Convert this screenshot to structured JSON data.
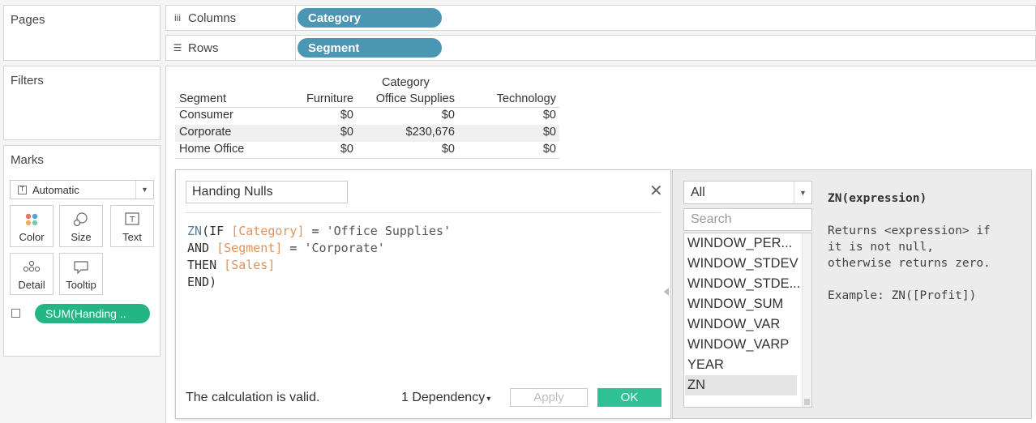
{
  "panels": {
    "pages": "Pages",
    "filters": "Filters",
    "marks": "Marks"
  },
  "marks": {
    "mark_type": "Automatic",
    "buttons": {
      "color": "Color",
      "size": "Size",
      "text": "Text",
      "detail": "Detail",
      "tooltip": "Tooltip"
    },
    "text_pill": "SUM(Handing .."
  },
  "shelves": {
    "columns_label": "Columns",
    "columns_pill": "Category",
    "rows_label": "Rows",
    "rows_pill": "Segment"
  },
  "crosstab": {
    "category_header": "Category",
    "row_header": "Segment",
    "columns": [
      "Furniture",
      "Office Supplies",
      "Technology"
    ],
    "rows": [
      {
        "segment": "Consumer",
        "values": [
          "$0",
          "$0",
          "$0"
        ]
      },
      {
        "segment": "Corporate",
        "values": [
          "$0",
          "$230,676",
          "$0"
        ]
      },
      {
        "segment": "Home Office",
        "values": [
          "$0",
          "$0",
          "$0"
        ]
      }
    ]
  },
  "calc": {
    "name": "Handing Nulls",
    "code": {
      "fn": "ZN",
      "l1_a": "(IF ",
      "f_category": "[Category]",
      "l1_b": " = ",
      "s_office": "'Office Supplies'",
      "l2_a": "AND ",
      "f_segment": "[Segment]",
      "l2_b": " = ",
      "s_corp": "'Corporate'",
      "l3_a": "THEN ",
      "f_sales": "[Sales]",
      "l4": "END)"
    },
    "status": "The calculation is valid.",
    "dependency": "1 Dependency",
    "apply": "Apply",
    "ok": "OK"
  },
  "functions": {
    "filter": "All",
    "search_placeholder": "Search",
    "items": [
      "WINDOW_PER...",
      "WINDOW_STDEV",
      "WINDOW_STDE...",
      "WINDOW_SUM",
      "WINDOW_VAR",
      "WINDOW_VARP",
      "YEAR",
      "ZN"
    ],
    "selected": "ZN",
    "doc": {
      "signature": "ZN(expression)",
      "line1": "Returns <expression> if",
      "line2": "it is not null,",
      "line3": "otherwise returns zero.",
      "example": "Example: ZN([Profit])"
    }
  }
}
